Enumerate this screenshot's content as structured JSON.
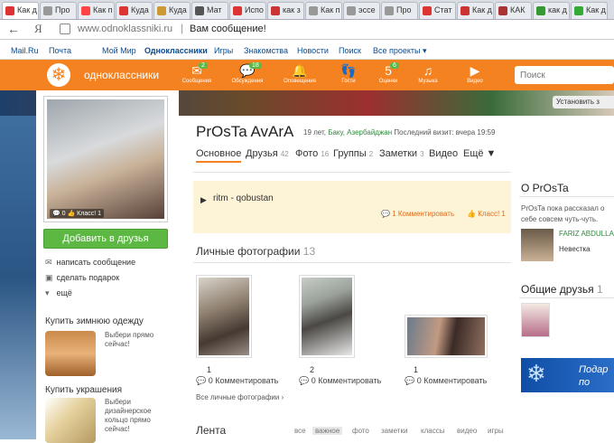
{
  "browser": {
    "tabs": [
      {
        "label": "Как д",
        "color": "#d33"
      },
      {
        "label": "Про",
        "color": "#999"
      },
      {
        "label": "Как п",
        "color": "#f44"
      },
      {
        "label": "Куда",
        "color": "#d33"
      },
      {
        "label": "Куда",
        "color": "#c93"
      },
      {
        "label": "Мат",
        "color": "#555"
      },
      {
        "label": "Испо",
        "color": "#d33"
      },
      {
        "label": "как з",
        "color": "#c33"
      },
      {
        "label": "Как п",
        "color": "#999"
      },
      {
        "label": "эссе",
        "color": "#999"
      },
      {
        "label": "Про",
        "color": "#999"
      },
      {
        "label": "Стат",
        "color": "#d33"
      },
      {
        "label": "Как д",
        "color": "#c33"
      },
      {
        "label": "КАК",
        "color": "#a33"
      },
      {
        "label": "как д",
        "color": "#393"
      },
      {
        "label": "Как д",
        "color": "#3a3"
      }
    ],
    "url": "www.odnoklassniki.ru",
    "page_title": "Вам сообщение!",
    "ya": "Я"
  },
  "mailru_nav": {
    "items": [
      "Mail.Ru",
      "Почта",
      "Мой Мир",
      "Одноклассники",
      "Игры",
      "Знакомства",
      "Новости",
      "Поиск",
      "Все проекты ▾"
    ]
  },
  "ok_nav": {
    "brand": "одноклассники",
    "items": [
      {
        "label": "Сообщения",
        "glyph": "✉",
        "badge": "2"
      },
      {
        "label": "Обсуждения",
        "glyph": "💬",
        "badge": "18"
      },
      {
        "label": "Оповещения",
        "glyph": "🔔",
        "badge": ""
      },
      {
        "label": "Гости",
        "glyph": "👣",
        "badge": ""
      },
      {
        "label": "Оценки",
        "glyph": "5",
        "badge": "6"
      },
      {
        "label": "Музыка",
        "glyph": "♫",
        "badge": ""
      },
      {
        "label": "Видео",
        "glyph": "▶",
        "badge": ""
      }
    ],
    "search_placeholder": "Поиск",
    "install_label": "Установить з"
  },
  "profile": {
    "photo_stats": "💬 0  👍 Класс! 1",
    "add_friend": "Добавить в друзья",
    "actions": [
      {
        "icon": "✉",
        "label": "написать сообщение"
      },
      {
        "icon": "▣",
        "label": "сделать подарок"
      },
      {
        "icon": "▾",
        "label": "ещё"
      }
    ],
    "ads": [
      {
        "title": "Купить зимнюю одежду",
        "text": "Выбери прямо сейчас!"
      },
      {
        "title": "Купить украшения",
        "text": "Выбери дизайнерское кольцо прямо сейчас!"
      }
    ],
    "name": "PrOsTa AvArA",
    "age": "19 лет,",
    "location": "Баку, Азербайджан",
    "last_visit": "Последний визит: вчера 19:59",
    "tabs": [
      {
        "label": "Основное",
        "count": ""
      },
      {
        "label": "Друзья",
        "count": "42"
      },
      {
        "label": "Фото",
        "count": "16"
      },
      {
        "label": "Группы",
        "count": "2"
      },
      {
        "label": "Заметки",
        "count": "3"
      },
      {
        "label": "Видео",
        "count": ""
      },
      {
        "label": "Ещё ▼",
        "count": ""
      }
    ],
    "status_song": "ritm - qobustan",
    "status_comments": "1 Комментировать",
    "status_likes": "Класс! 1",
    "photos_heading": "Личные фотографии",
    "photos_count": "13",
    "photos": [
      {
        "num": "1",
        "comments": "0 Комментировать"
      },
      {
        "num": "2",
        "comments": "0 Комментировать"
      },
      {
        "num": "1",
        "comments": "0 Комментировать"
      }
    ],
    "all_photos": "Все личные фотографии ›",
    "lenta": "Лента",
    "lenta_tabs": [
      "все",
      "важное",
      "фото",
      "заметки",
      "классы",
      "видео",
      "игры"
    ]
  },
  "right": {
    "about_heading": "О PrOsTa",
    "about_text": "PrOsTa пока рассказал о себе совсем чуть-чуть.",
    "friend_name": "FARIZ ABDULLA",
    "friend_relation": "Невестка",
    "mutual_heading": "Общие друзья",
    "mutual_count": "1",
    "ad_text": "Подар по"
  }
}
